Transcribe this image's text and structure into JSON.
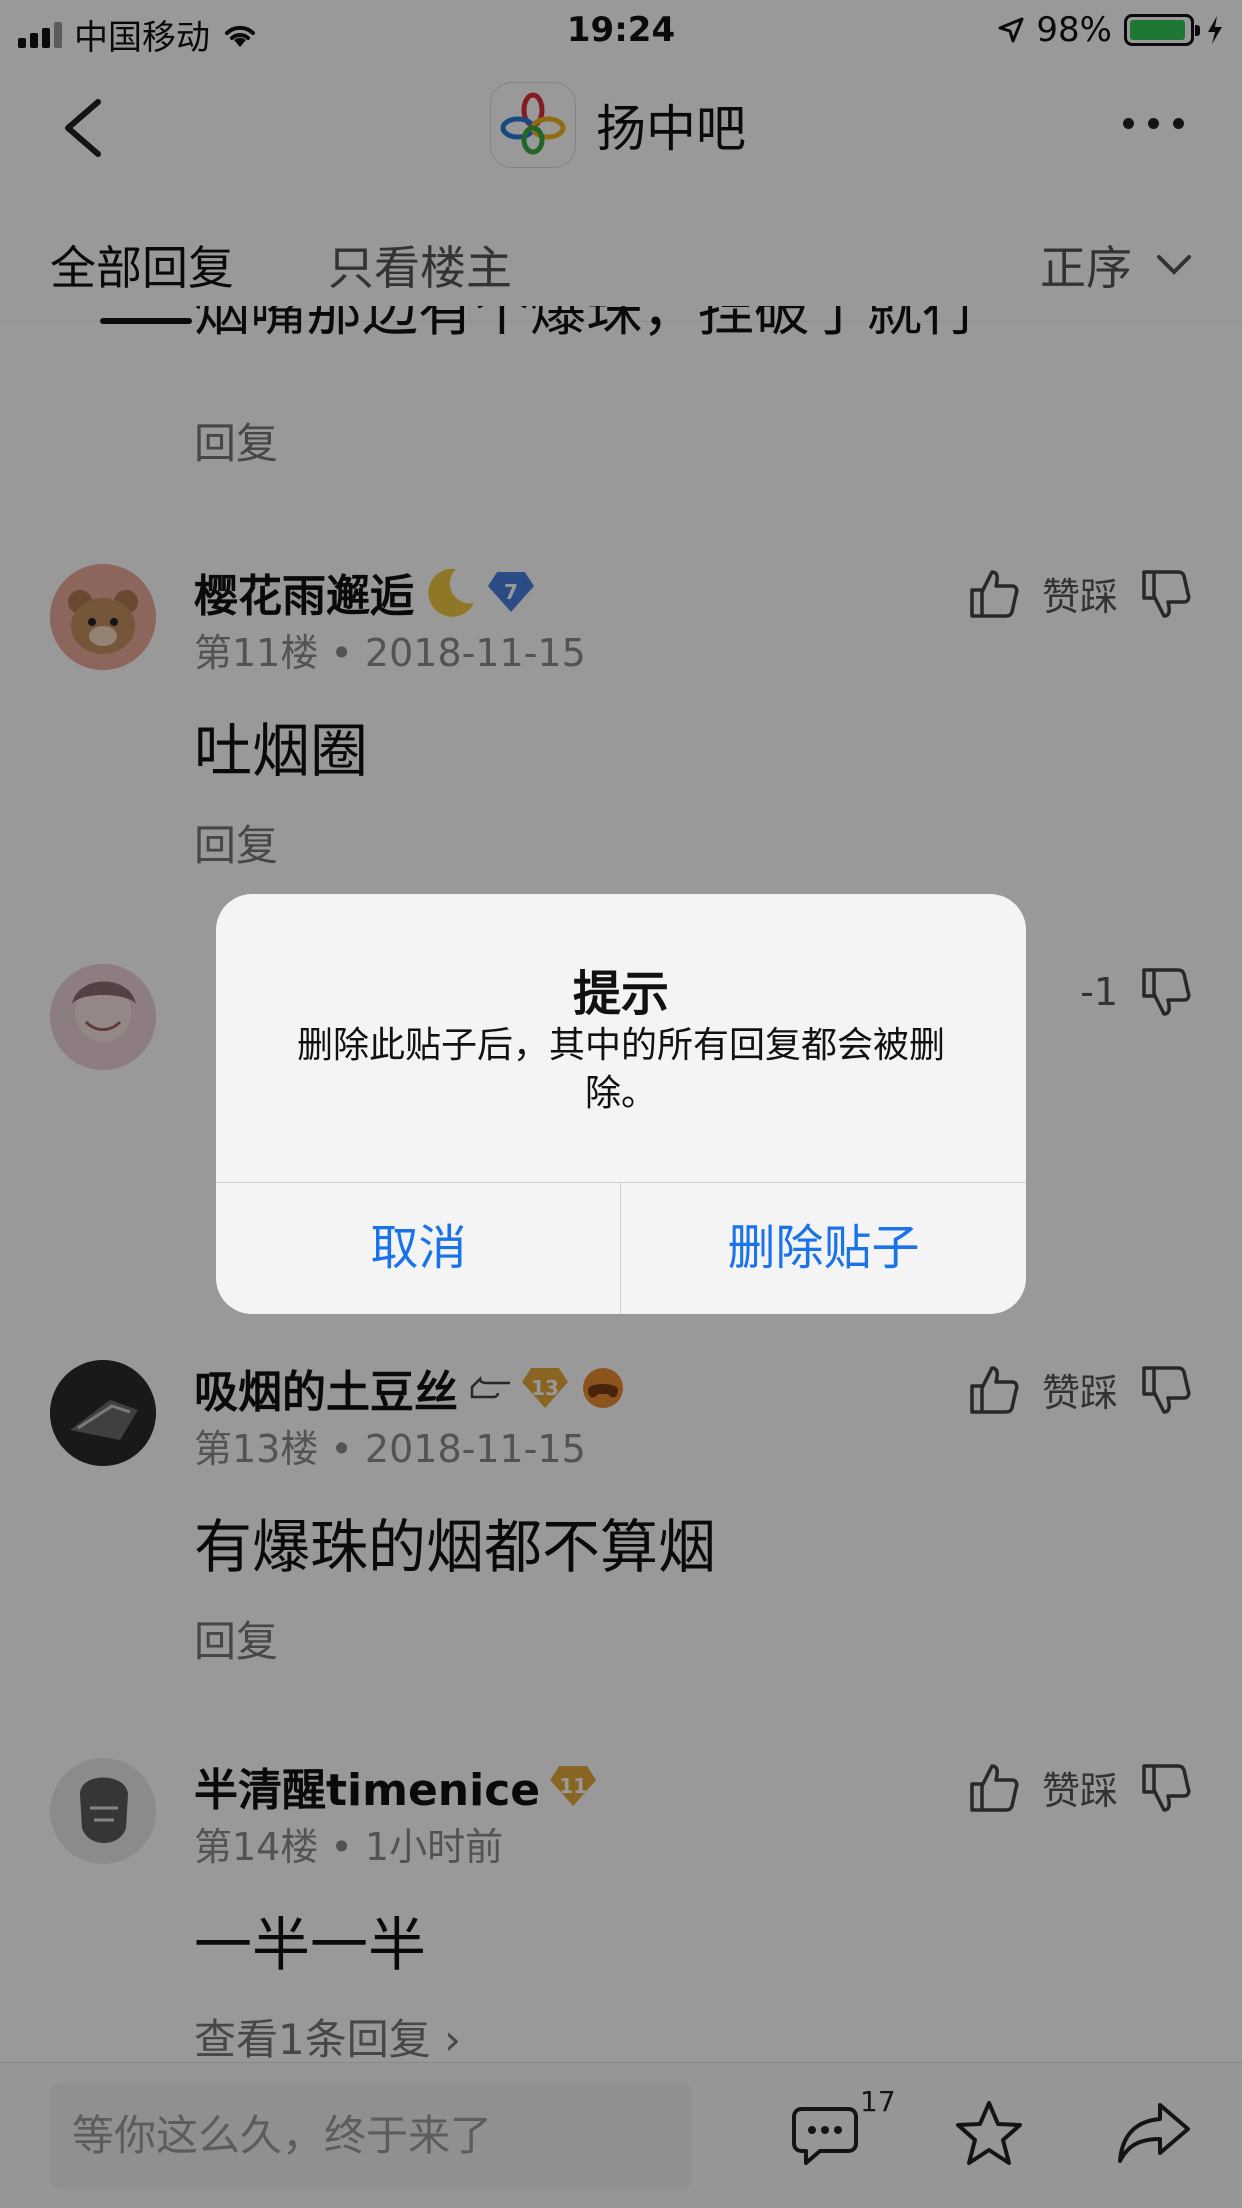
{
  "status_bar": {
    "carrier": "中国移动",
    "time": "19:24",
    "battery": "98%"
  },
  "header": {
    "forum_name": "扬中吧"
  },
  "tabs": {
    "all": "全部回复",
    "op_only": "只看楼主",
    "sort": "正序"
  },
  "partial_post": {
    "content": "烟嘴那边有个爆珠，捏破了就行",
    "reply_label": "回复"
  },
  "posts": [
    {
      "user": "樱花雨邂逅",
      "level": "7",
      "floor_meta": "第11楼 • 2018-11-15",
      "content": "吐烟圈",
      "reply_label": "回复",
      "vote_label": "赞踩"
    },
    {
      "vote_count": "-1"
    },
    {
      "user": "吸烟的土豆丝",
      "level": "13",
      "floor_meta": "第13楼 • 2018-11-15",
      "content": "有爆珠的烟都不算烟",
      "reply_label": "回复",
      "vote_label": "赞踩"
    },
    {
      "user": "半清醒timenice",
      "level": "11",
      "floor_meta": "第14楼 • 1小时前",
      "content": "一半一半",
      "reply_label": "查看1条回复 ›",
      "vote_label": "赞踩"
    }
  ],
  "bottom_bar": {
    "placeholder": "等你这么久，终于来了",
    "comment_count": "17"
  },
  "alert": {
    "title": "提示",
    "message": "删除此贴子后，其中的所有回复都会被删除。",
    "cancel": "取消",
    "confirm": "删除贴子"
  },
  "colors": {
    "accent": "#1a73e8",
    "battery": "#35c759",
    "badge_blue": "#4a7fe0",
    "badge_gold": "#e4a93b"
  }
}
